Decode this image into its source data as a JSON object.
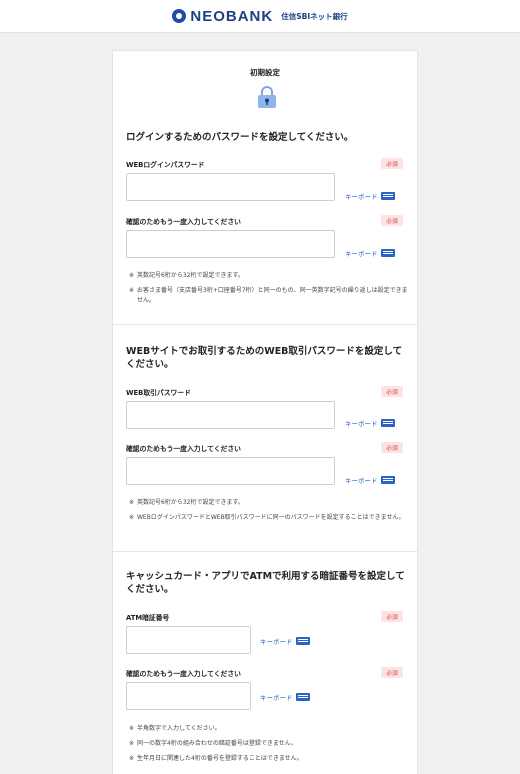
{
  "brand": {
    "name": "NEOBANK",
    "sub": "住信SBIネット銀行"
  },
  "header": {
    "title": "初期設定",
    "icon": "lock-icon"
  },
  "keyboard_label": "キーボード",
  "required_label": "必須",
  "section1": {
    "title": "ログインするためのパスワードを設定してください。",
    "field1_label": "WEBログインパスワード",
    "field2_label": "確認のためもう一度入力してください",
    "notes": [
      "英数記号6桁から32桁で設定できます。",
      "お客さま番号（支店番号3桁+口座番号7桁）と同一のもの、同一英数字記号の繰り返しは設定できません。"
    ]
  },
  "section2": {
    "title": "WEBサイトでお取引するためのWEB取引パスワードを設定してください。",
    "field1_label": "WEB取引パスワード",
    "field2_label": "確認のためもう一度入力してください",
    "notes": [
      "英数記号6桁から32桁で設定できます。",
      "WEBログインパスワードとWEB取引パスワードに同一のパスワードを設定することはできません。"
    ]
  },
  "section3": {
    "title": "キャッシュカード・アプリでATMで利用する暗証番号を設定してください。",
    "field1_label": "ATM暗証番号",
    "field2_label": "確認のためもう一度入力してください",
    "notes": [
      "半角数字で入力してください。",
      "同一の数字4桁の組み合わせの暗証番号は登録できません。",
      "生年月日に関連した4桁の番号を登録することはできません。"
    ]
  }
}
